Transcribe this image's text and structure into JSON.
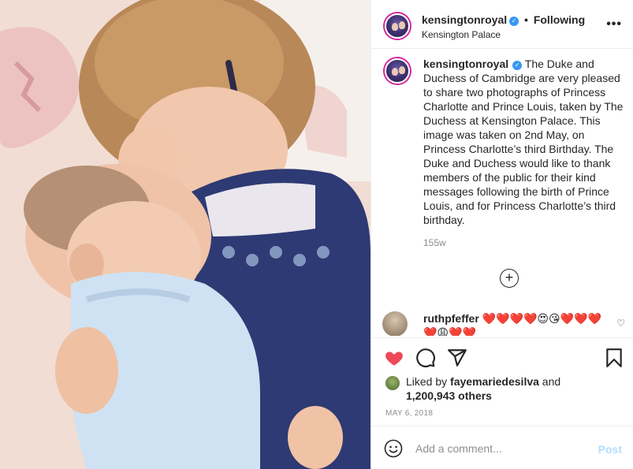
{
  "post": {
    "username": "kensingtonroyal",
    "follow_status": "Following",
    "location": "Kensington Palace",
    "caption": "The Duke and Duchess of Cambridge are very pleased to share two photographs of Princess Charlotte and Prince Louis, taken by The Duchess at Kensington Palace. This image was taken on 2nd May, on Princess Charlotte’s third Birthday. The Duke and Duchess would like to thank members of the public for their kind messages following the birth of Prince Louis, and for Princess Charlotte’s third birthday.",
    "time_ago": "155w",
    "load_more": "+",
    "date": "MAY 6, 2018"
  },
  "comment": {
    "username": "ruthpfeffer",
    "text": "❤️❤️❤️❤️😍😘❤️❤️❤️❤️😩❤️❤️"
  },
  "likes": {
    "prefix": "Liked by",
    "liker": "fayemariedesilva",
    "and": "and",
    "count": "1,200,943 others"
  },
  "comment_box": {
    "placeholder": "Add a comment...",
    "post_label": "Post"
  },
  "colors": {
    "like_red": "#ed4956",
    "verified_blue": "#3897f0",
    "post_disabled": "#b2dffc",
    "muted_text": "#8e8e8e"
  },
  "icons": {
    "more": "more-options-icon",
    "like": "heart-filled-icon",
    "comment": "comment-icon",
    "share": "share-icon",
    "save": "bookmark-icon",
    "emoji": "emoji-icon",
    "comment_like": "heart-outline-icon",
    "verified": "verified-badge-icon"
  }
}
